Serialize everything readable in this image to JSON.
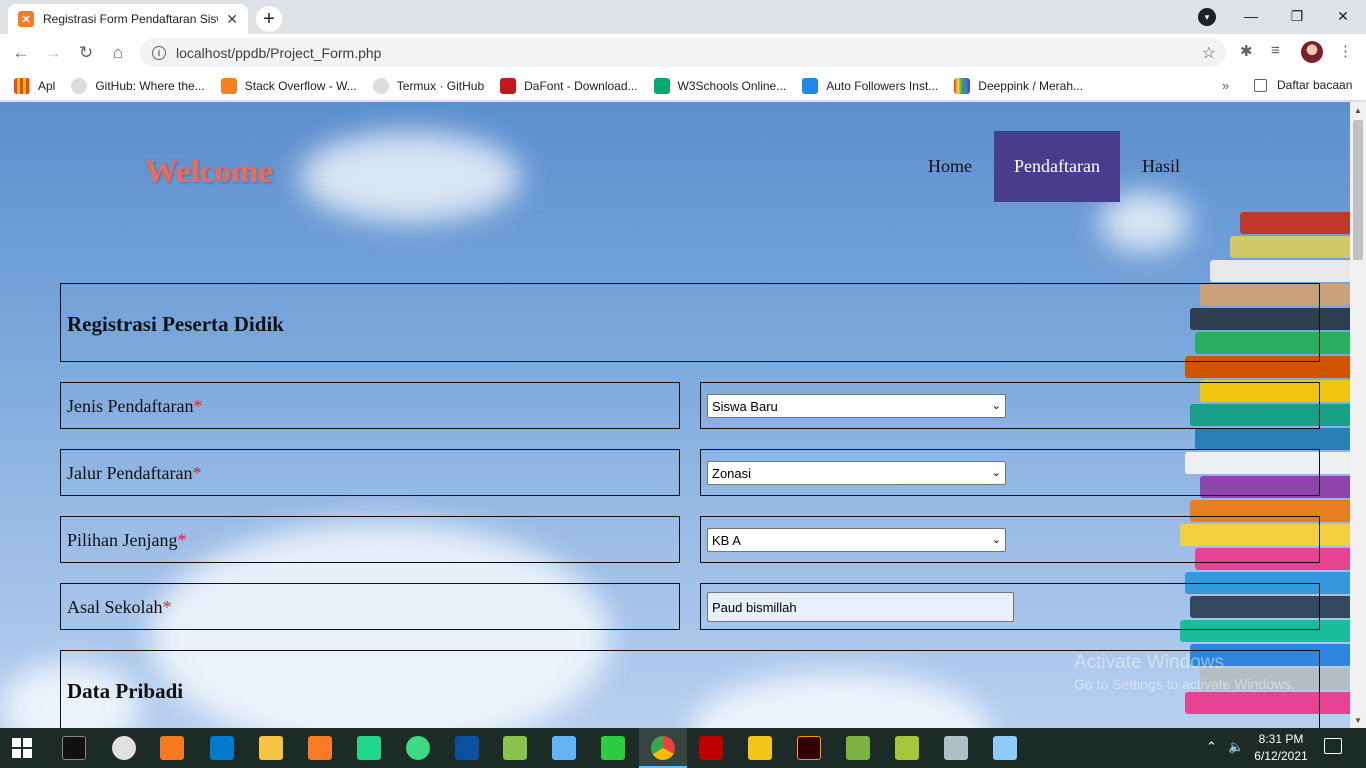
{
  "browser": {
    "tab_title": "Registrasi Form Pendaftaran Siswa",
    "tab_close": "✕",
    "new_tab": "+",
    "url": "localhost/ppdb/Project_Form.php",
    "window_controls": {
      "minimize": "—",
      "maximize": "❐",
      "close": "✕"
    },
    "bookmarks": [
      {
        "label": "Apl",
        "color": "#e8453c"
      },
      {
        "label": "GitHub: Where the...",
        "color": "#ffffff"
      },
      {
        "label": "Stack Overflow - W...",
        "color": "#f48024"
      },
      {
        "label": "Termux · GitHub",
        "color": "#ffffff"
      },
      {
        "label": "DaFont - Download...",
        "color": "#c4161c"
      },
      {
        "label": "W3Schools Online...",
        "color": "#04aa6d"
      },
      {
        "label": "Auto Followers Inst...",
        "color": "#1e88e5"
      },
      {
        "label": "Deeppink / Merah...",
        "color": "#7b3fb4"
      }
    ],
    "bookmarks_more": "»",
    "reading_list": "Daftar bacaan"
  },
  "site": {
    "welcome": "Welcome",
    "menu": [
      {
        "label": "Home",
        "active": false
      },
      {
        "label": "Pendaftaran",
        "active": true
      },
      {
        "label": "Hasil",
        "active": false
      }
    ]
  },
  "form": {
    "section1_title": "Registrasi Peserta Didik",
    "required_mark": "*",
    "fields": [
      {
        "label": "Jenis Pendaftaran",
        "type": "select",
        "value": "Siswa Baru"
      },
      {
        "label": "Jalur Pendaftaran",
        "type": "select",
        "value": "Zonasi"
      },
      {
        "label": "Pilihan Jenjang",
        "type": "select",
        "value": "KB A"
      },
      {
        "label": "Asal Sekolah",
        "type": "text",
        "value": "Paud bismillah"
      }
    ],
    "section2_title": "Data Pribadi"
  },
  "watermark": {
    "line1": "Activate Windows",
    "line2": "Go to Settings to activate Windows."
  },
  "taskbar": {
    "time": "8:31 PM",
    "date": "6/12/2021"
  },
  "colors": {
    "accent_menu": "#4a3c8c",
    "welcome": "#f06a5a",
    "required": "#e0203a"
  }
}
